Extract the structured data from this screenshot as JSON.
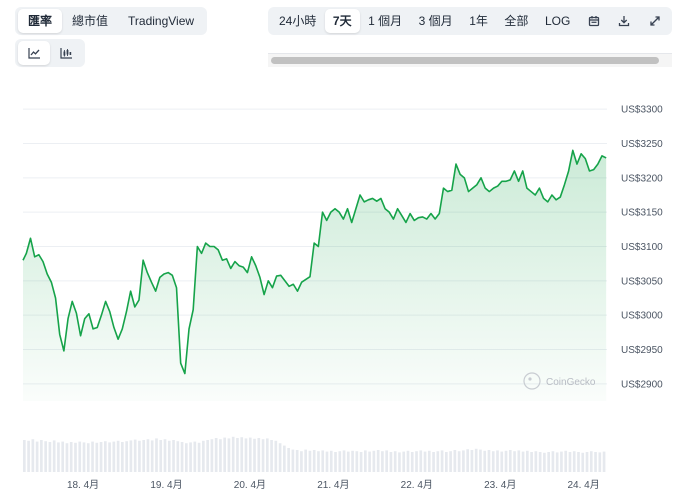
{
  "tabs_left": [
    {
      "label": "匯率",
      "active": true
    },
    {
      "label": "總市值",
      "active": false
    },
    {
      "label": "TradingView",
      "active": false
    }
  ],
  "range_tabs": [
    {
      "label": "24小時",
      "active": false
    },
    {
      "label": "7天",
      "active": true
    },
    {
      "label": "1 個月",
      "active": false
    },
    {
      "label": "3 個月",
      "active": false
    },
    {
      "label": "1年",
      "active": false
    },
    {
      "label": "全部",
      "active": false
    },
    {
      "label": "LOG",
      "active": false
    }
  ],
  "tool_icons": [
    "calendar-icon",
    "download-icon",
    "expand-icon"
  ],
  "chart_type_icons": [
    {
      "icon": "line-chart-icon",
      "active": true
    },
    {
      "icon": "candlestick-icon",
      "active": false
    }
  ],
  "watermark": "CoinGecko",
  "colors": {
    "line": "#16a34a",
    "fill_top": "#16a34a",
    "volume": "#e6e9ee",
    "grid": "#eceff3"
  },
  "chart_data": {
    "type": "line",
    "y_unit_prefix": "US$",
    "ylim": [
      2875,
      3325
    ],
    "y_ticks": [
      2900,
      2950,
      3000,
      3050,
      3100,
      3150,
      3200,
      3250,
      3300
    ],
    "y_tick_labels": [
      "US$2900",
      "US$2950",
      "US$3000",
      "US$3050",
      "US$3100",
      "US$3150",
      "US$3200",
      "US$3250",
      "US$3300"
    ],
    "x_tick_labels": [
      "18. 4月",
      "19. 4月",
      "20. 4月",
      "21. 4月",
      "22. 4月",
      "23. 4月",
      "24. 4月"
    ],
    "x_range_days": [
      17.28,
      24.28
    ],
    "x_tick_days": [
      18,
      19,
      20,
      21,
      22,
      23,
      24
    ],
    "grid": true,
    "series": [
      {
        "x": [
          17.28,
          17.32,
          17.37,
          17.42,
          17.47,
          17.52,
          17.57,
          17.62,
          17.67,
          17.72,
          17.77,
          17.82,
          17.87,
          17.92,
          17.97,
          18.02,
          18.07,
          18.12,
          18.17,
          18.22,
          18.27,
          18.32,
          18.37,
          18.42,
          18.47,
          18.52,
          18.57,
          18.62,
          18.67,
          18.72,
          18.77,
          18.82,
          18.87,
          18.92,
          18.97,
          19.02,
          19.07,
          19.12,
          19.17,
          19.22,
          19.27,
          19.32,
          19.37,
          19.42,
          19.47,
          19.52,
          19.57,
          19.62,
          19.67,
          19.72,
          19.77,
          19.82,
          19.87,
          19.92,
          19.97,
          20.02,
          20.07,
          20.12,
          20.17,
          20.22,
          20.27,
          20.32,
          20.37,
          20.42,
          20.47,
          20.52,
          20.57,
          20.62,
          20.67,
          20.72,
          20.77,
          20.82,
          20.87,
          20.92,
          20.97,
          21.02,
          21.07,
          21.12,
          21.17,
          21.22,
          21.27,
          21.32,
          21.37,
          21.42,
          21.47,
          21.52,
          21.57,
          21.62,
          21.67,
          21.72,
          21.77,
          21.82,
          21.87,
          21.92,
          21.97,
          22.02,
          22.07,
          22.12,
          22.17,
          22.22,
          22.27,
          22.32,
          22.37,
          22.42,
          22.47,
          22.52,
          22.57,
          22.62,
          22.67,
          22.72,
          22.77,
          22.82,
          22.87,
          22.92,
          22.97,
          23.02,
          23.07,
          23.12,
          23.17,
          23.22,
          23.27,
          23.32,
          23.37,
          23.42,
          23.47,
          23.52,
          23.57,
          23.62,
          23.67,
          23.72,
          23.77,
          23.82,
          23.87,
          23.92,
          23.97,
          24.02,
          24.07,
          24.12,
          24.17,
          24.22,
          24.27
        ],
        "y": [
          3080,
          3090,
          3112,
          3085,
          3088,
          3078,
          3060,
          3048,
          3025,
          2972,
          2948,
          2995,
          3020,
          3003,
          2970,
          2995,
          3002,
          2980,
          2982,
          3000,
          3020,
          3005,
          2982,
          2965,
          2980,
          3005,
          3035,
          3012,
          3022,
          3080,
          3062,
          3048,
          3035,
          3055,
          3060,
          3062,
          3058,
          3040,
          2930,
          2915,
          2980,
          3008,
          3100,
          3090,
          3105,
          3100,
          3100,
          3095,
          3080,
          3082,
          3068,
          3078,
          3072,
          3070,
          3062,
          3085,
          3072,
          3055,
          3030,
          3050,
          3040,
          3057,
          3058,
          3050,
          3042,
          3045,
          3035,
          3048,
          3052,
          3056,
          3105,
          3100,
          3150,
          3138,
          3150,
          3155,
          3150,
          3140,
          3155,
          3135,
          3155,
          3175,
          3165,
          3168,
          3170,
          3166,
          3170,
          3155,
          3150,
          3140,
          3155,
          3145,
          3135,
          3148,
          3138,
          3142,
          3143,
          3140,
          3148,
          3140,
          3148,
          3185,
          3180,
          3182,
          3220,
          3205,
          3200,
          3180,
          3185,
          3190,
          3200,
          3185,
          3180,
          3185,
          3188,
          3195,
          3195,
          3197,
          3210,
          3195,
          3210,
          3185,
          3180,
          3175,
          3185,
          3170,
          3165,
          3175,
          3168,
          3172,
          3190,
          3210,
          3240,
          3220,
          3235,
          3228,
          3210,
          3212,
          3220,
          3232,
          3229
        ]
      }
    ],
    "volume": {
      "x_start": 17.28,
      "x_end": 24.28,
      "values": [
        0.8,
        0.78,
        0.82,
        0.76,
        0.8,
        0.77,
        0.75,
        0.79,
        0.74,
        0.76,
        0.72,
        0.75,
        0.73,
        0.76,
        0.74,
        0.72,
        0.76,
        0.73,
        0.75,
        0.77,
        0.74,
        0.76,
        0.78,
        0.75,
        0.77,
        0.79,
        0.81,
        0.78,
        0.8,
        0.82,
        0.79,
        0.84,
        0.8,
        0.82,
        0.78,
        0.8,
        0.77,
        0.75,
        0.72,
        0.74,
        0.76,
        0.73,
        0.78,
        0.8,
        0.82,
        0.85,
        0.82,
        0.86,
        0.84,
        0.88,
        0.85,
        0.87,
        0.84,
        0.86,
        0.83,
        0.85,
        0.82,
        0.84,
        0.8,
        0.78,
        0.72,
        0.66,
        0.6,
        0.56,
        0.55,
        0.52,
        0.56,
        0.53,
        0.55,
        0.52,
        0.54,
        0.51,
        0.53,
        0.5,
        0.52,
        0.54,
        0.51,
        0.53,
        0.52,
        0.5,
        0.54,
        0.51,
        0.53,
        0.55,
        0.52,
        0.54,
        0.5,
        0.52,
        0.49,
        0.51,
        0.53,
        0.5,
        0.52,
        0.54,
        0.51,
        0.53,
        0.5,
        0.52,
        0.54,
        0.5,
        0.52,
        0.55,
        0.52,
        0.54,
        0.57,
        0.55,
        0.58,
        0.56,
        0.53,
        0.55,
        0.52,
        0.54,
        0.51,
        0.53,
        0.55,
        0.52,
        0.54,
        0.51,
        0.53,
        0.5,
        0.52,
        0.5,
        0.48,
        0.5,
        0.52,
        0.49,
        0.51,
        0.53,
        0.5,
        0.52,
        0.5,
        0.48,
        0.5,
        0.52,
        0.5,
        0.49,
        0.51
      ]
    }
  }
}
